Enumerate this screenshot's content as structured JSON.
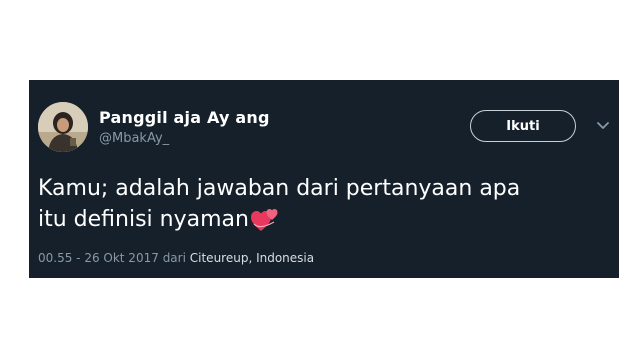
{
  "tweet": {
    "display_name": "Panggil aja Ay ang",
    "username": "@MbakAy_",
    "follow_label": "Ikuti",
    "text_line1": "Kamu; adalah jawaban dari pertanyaan apa",
    "text_line2": "itu definisi nyaman",
    "emoji": "revolving-hearts",
    "timestamp": "00.55 - 26 Okt 2017",
    "from_word": "dari",
    "location": "Citeureup, Indonesia"
  },
  "icons": {
    "menu": "chevron-down-icon",
    "emoji": "revolving-hearts-icon"
  },
  "colors": {
    "card_background": "#15202b",
    "primary_text": "#ffffff",
    "secondary_text": "#8899a6"
  }
}
